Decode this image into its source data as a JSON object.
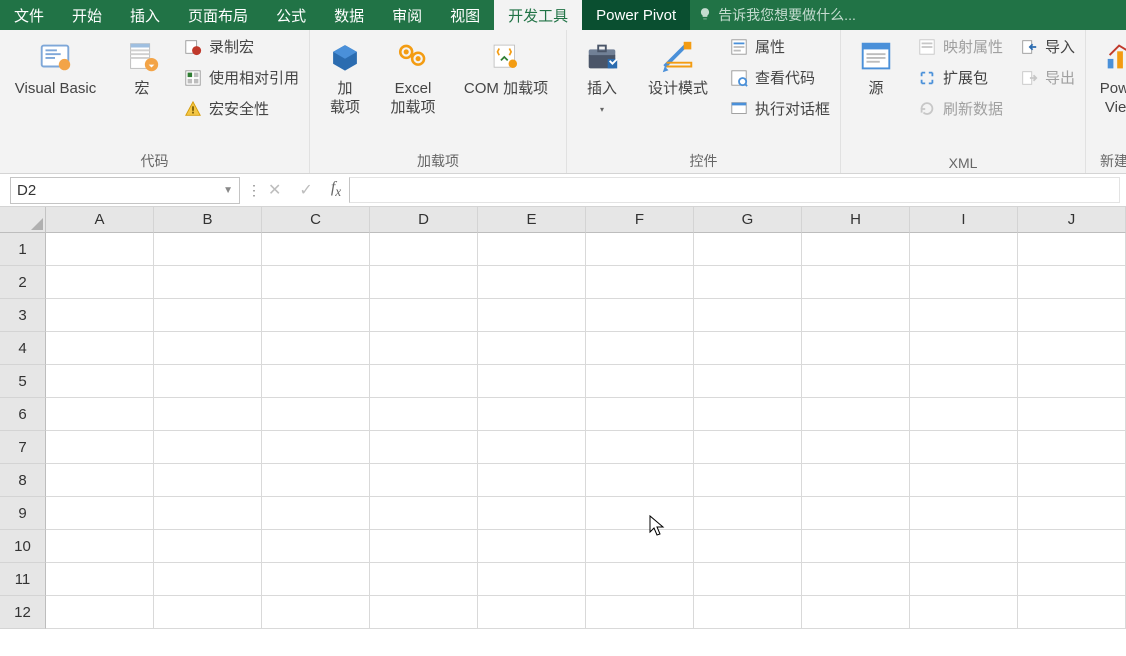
{
  "tabs": {
    "file": "文件",
    "home": "开始",
    "insert": "插入",
    "page_layout": "页面布局",
    "formulas": "公式",
    "data": "数据",
    "review": "审阅",
    "view": "视图",
    "developer": "开发工具",
    "power_pivot": "Power Pivot"
  },
  "tell_me_placeholder": "告诉我您想要做什么...",
  "ribbon": {
    "code": {
      "label": "代码",
      "visual_basic": "Visual Basic",
      "macros": "宏",
      "record_macro": "录制宏",
      "use_relative": "使用相对引用",
      "macro_security": "宏安全性"
    },
    "addins": {
      "label": "加载项",
      "addins_btn": "加\n载项",
      "excel_addins": "Excel\n加载项",
      "com_addins": "COM 加载项"
    },
    "controls": {
      "label": "控件",
      "insert": "插入",
      "design_mode": "设计模式",
      "properties": "属性",
      "view_code": "查看代码",
      "run_dialog": "执行对话框"
    },
    "xml": {
      "label": "XML",
      "source": "源",
      "map_properties": "映射属性",
      "expansion": "扩展包",
      "refresh": "刷新数据",
      "import": "导入",
      "export": "导出"
    },
    "powerview": {
      "label": "新建组",
      "btn": "Power\nView"
    }
  },
  "name_box": "D2",
  "columns": [
    "A",
    "B",
    "C",
    "D",
    "E",
    "F",
    "G",
    "H",
    "I",
    "J"
  ],
  "rows": [
    "1",
    "2",
    "3",
    "4",
    "5",
    "6",
    "7",
    "8",
    "9",
    "10",
    "11",
    "12"
  ]
}
